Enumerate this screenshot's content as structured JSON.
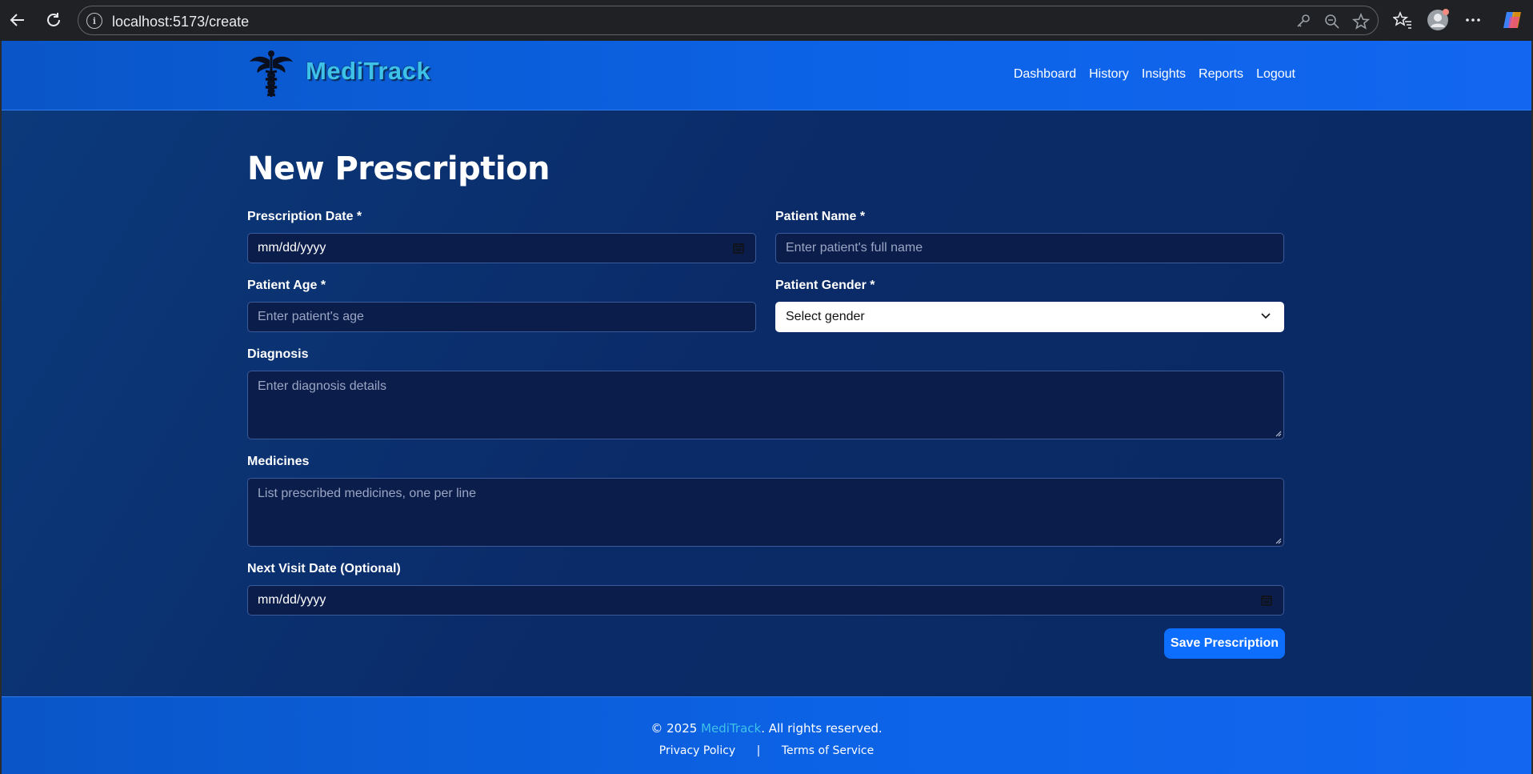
{
  "browser": {
    "url": "localhost:5173/create",
    "info_icon": "i"
  },
  "brand": {
    "name": "MediTrack"
  },
  "nav": {
    "links": [
      "Dashboard",
      "History",
      "Insights",
      "Reports",
      "Logout"
    ]
  },
  "form": {
    "title": "New Prescription",
    "prescription_date": {
      "label": "Prescription Date *",
      "value": "mm/dd/yyyy"
    },
    "patient_name": {
      "label": "Patient Name *",
      "placeholder": "Enter patient's full name"
    },
    "patient_age": {
      "label": "Patient Age *",
      "placeholder": "Enter patient's age"
    },
    "patient_gender": {
      "label": "Patient Gender *",
      "value": "Select gender"
    },
    "diagnosis": {
      "label": "Diagnosis",
      "placeholder": "Enter diagnosis details"
    },
    "medicines": {
      "label": "Medicines",
      "placeholder": "List prescribed medicines, one per line"
    },
    "next_visit": {
      "label": "Next Visit Date (Optional)",
      "value": "mm/dd/yyyy"
    },
    "save_label": "Save Prescription"
  },
  "footer": {
    "copyright_prefix": "© 2025 ",
    "brand": "MediTrack",
    "copyright_suffix": ". All rights reserved.",
    "privacy": "Privacy Policy",
    "separator": "|",
    "terms": "Terms of Service"
  }
}
